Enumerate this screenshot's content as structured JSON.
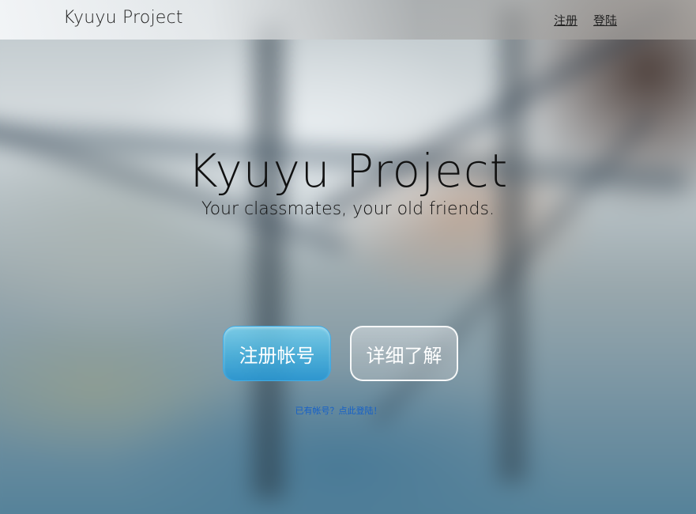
{
  "navbar": {
    "brand": "Kyuyu Project",
    "links": {
      "register": "注册",
      "login": "登陆"
    }
  },
  "hero": {
    "title": "Kyuyu Project",
    "subtitle": "Your classmates, your old friends."
  },
  "actions": {
    "register_button": "注册帐号",
    "learn_more_button": "详细了解",
    "login_hint": "已有帐号？点此登陆！"
  },
  "colors": {
    "primary_button": "#4fb4e0",
    "link": "#1560c8"
  }
}
